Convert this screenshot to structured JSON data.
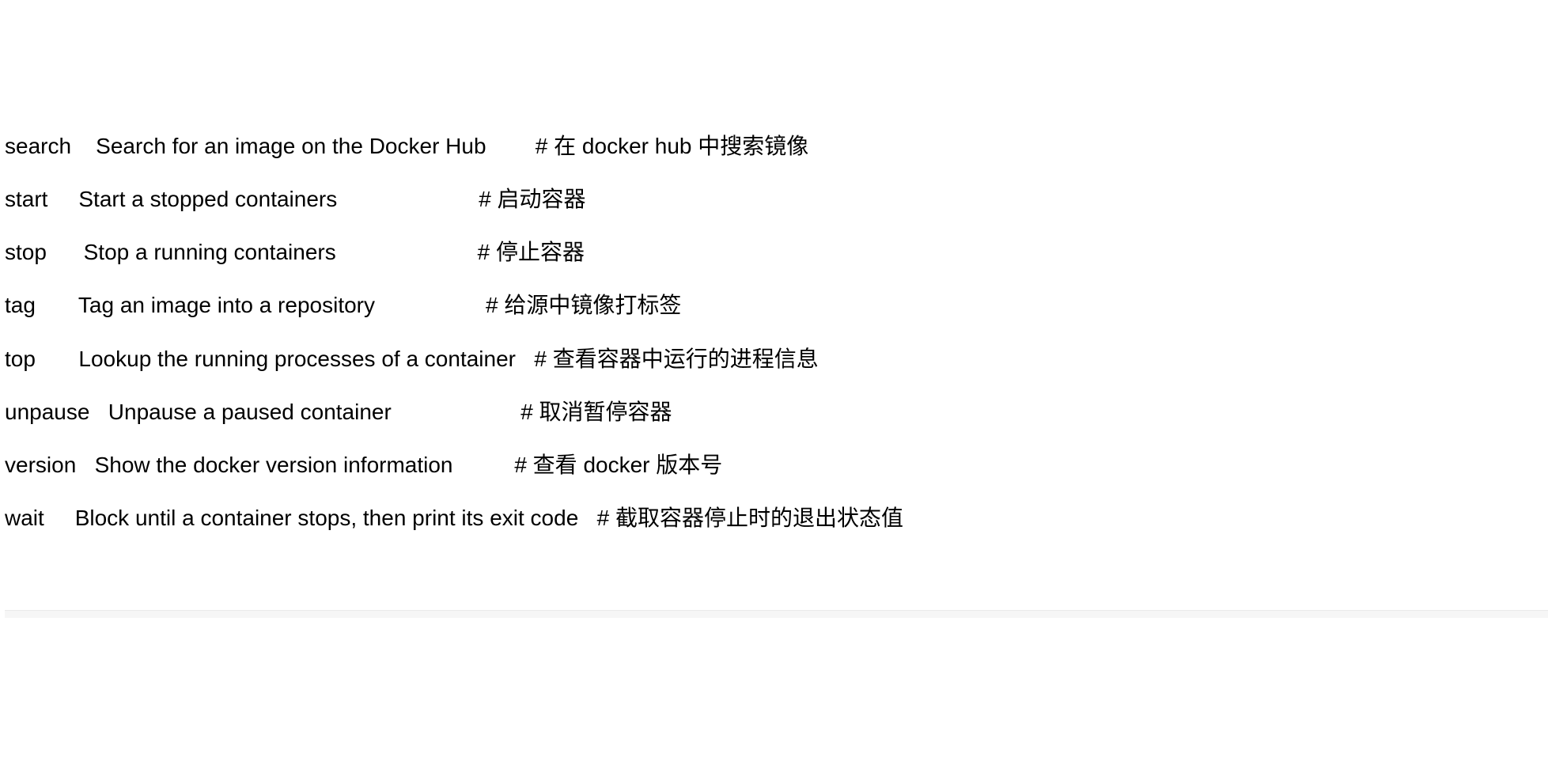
{
  "rows": [
    {
      "cmd": "search",
      "gap1": "    ",
      "desc": "Search for an image on the Docker Hub",
      "gap2": "        ",
      "comment": "# 在 docker hub 中搜索镜像"
    },
    {
      "cmd": "start",
      "gap1": "     ",
      "desc": "Start a stopped containers",
      "gap2": "                       ",
      "comment": "# 启动容器"
    },
    {
      "cmd": "stop",
      "gap1": "      ",
      "desc": "Stop a running containers",
      "gap2": "                       ",
      "comment": "# 停止容器"
    },
    {
      "cmd": "tag",
      "gap1": "       ",
      "desc": "Tag an image into a repository",
      "gap2": "                  ",
      "comment": "# 给源中镜像打标签"
    },
    {
      "cmd": "top",
      "gap1": "       ",
      "desc": "Lookup the running processes of a container",
      "gap2": "   ",
      "comment": "# 查看容器中运行的进程信息"
    },
    {
      "cmd": "unpause",
      "gap1": "   ",
      "desc": "Unpause a paused container",
      "gap2": "                     ",
      "comment": "# 取消暂停容器"
    },
    {
      "cmd": "version",
      "gap1": "   ",
      "desc": "Show the docker version information",
      "gap2": "          ",
      "comment": "# 查看 docker 版本号"
    },
    {
      "cmd": "wait",
      "gap1": "     ",
      "desc": "Block until a container stops, then print its exit code",
      "gap2": "   ",
      "comment": "# 截取容器停止时的退出状态值"
    }
  ]
}
